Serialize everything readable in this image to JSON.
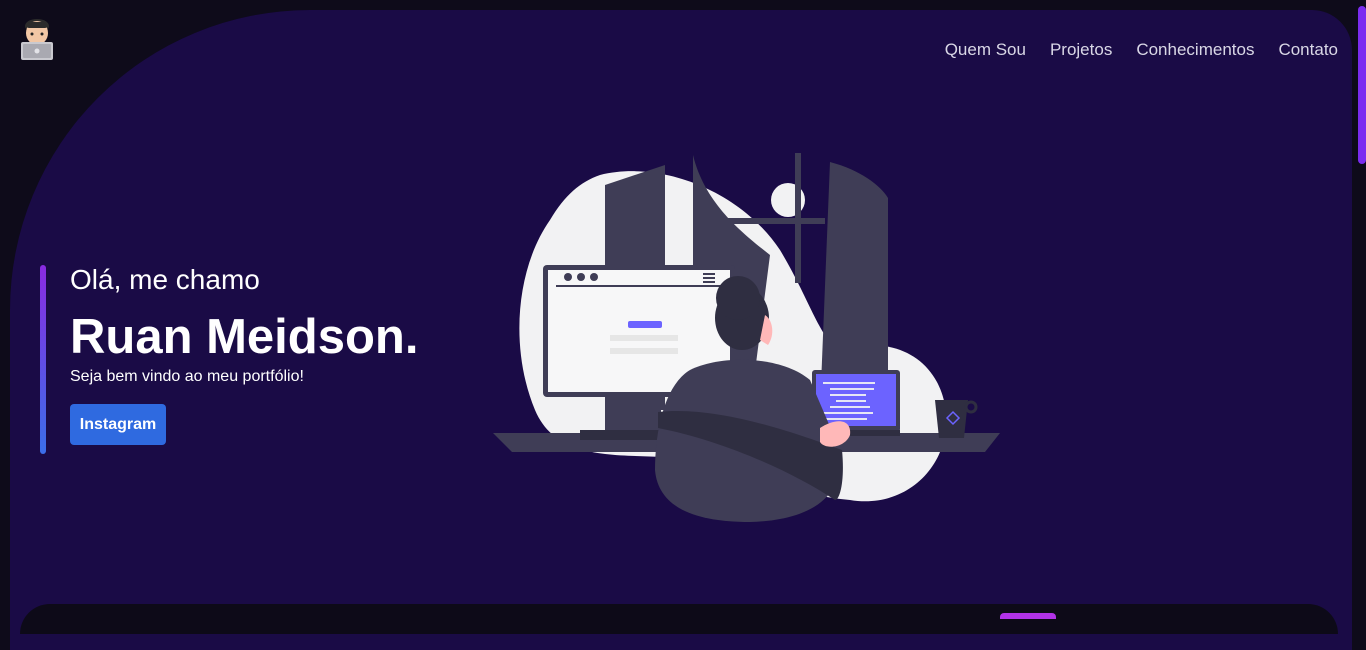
{
  "header": {
    "logo_icon": "developer-avatar-icon",
    "nav": [
      {
        "label": "Quem Sou"
      },
      {
        "label": "Projetos"
      },
      {
        "label": "Conhecimentos"
      },
      {
        "label": "Contato"
      }
    ]
  },
  "hero": {
    "greeting": "Olá, me chamo",
    "name": "Ruan Meidson.",
    "subtitle": "Seja bem vindo ao meu portfólio!",
    "button_label": "Instagram",
    "illustration_icon": "developer-at-desk-illustration"
  },
  "colors": {
    "page_bg": "#0e0b1a",
    "hero_bg": "#1a0b46",
    "button": "#2f6ae0",
    "accent_purple": "#8a2be2",
    "code_screen": "#6c63ff"
  }
}
